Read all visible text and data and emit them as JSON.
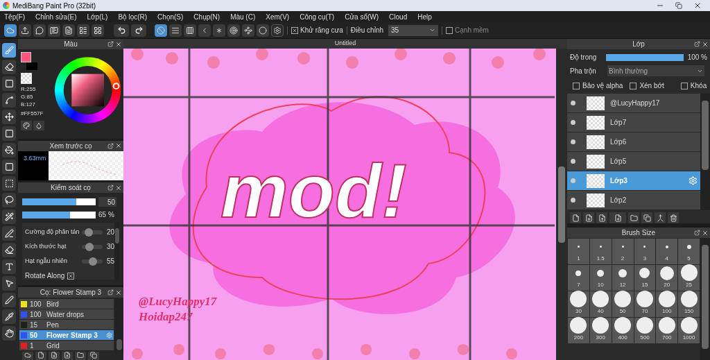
{
  "window": {
    "title": "MediBang Paint Pro (32bit)"
  },
  "menu": [
    "Tệp(F)",
    "Chỉnh sửa(E)",
    "Lớp(L)",
    "Bộ lọc(R)",
    "Chọn(S)",
    "Chụp(N)",
    "Màu (C)",
    "Xem(V)",
    "Công cụ(T)",
    "Cửa sổ(W)",
    "Cloud",
    "Help"
  ],
  "toolbar": {
    "snap_modes": [
      {
        "kind": "none",
        "selected": true
      },
      {
        "kind": "parallel",
        "selected": false
      },
      {
        "kind": "cross",
        "selected": false
      },
      {
        "kind": "vanish",
        "selected": false
      },
      {
        "kind": "radial",
        "selected": false
      },
      {
        "kind": "circle",
        "selected": false
      },
      {
        "kind": "curve",
        "selected": false
      },
      {
        "kind": "ellipse",
        "selected": false
      }
    ],
    "antialias": {
      "label": "Khử răng cưa",
      "checked": true
    },
    "correction": {
      "label": "Điều chỉnh",
      "value": "35"
    },
    "soft_edge": {
      "label": "Cạnh mềm",
      "checked": false
    }
  },
  "tools": [
    {
      "kind": "brush",
      "selected": true
    },
    {
      "kind": "eraser",
      "selected": false
    },
    {
      "kind": "dot",
      "selected": false
    },
    {
      "kind": "vector",
      "selected": false
    },
    {
      "kind": "move",
      "selected": false
    },
    {
      "kind": "fill",
      "selected": false
    },
    {
      "kind": "bucket",
      "selected": false
    },
    {
      "kind": "gradient",
      "selected": false
    },
    {
      "kind": "select",
      "selected": false
    },
    {
      "kind": "lasso",
      "selected": false
    },
    {
      "kind": "wand",
      "selected": false
    },
    {
      "kind": "selpen",
      "selected": false
    },
    {
      "kind": "selerase",
      "selected": false
    },
    {
      "kind": "text",
      "selected": false
    },
    {
      "kind": "operation",
      "selected": false
    },
    {
      "kind": "divide",
      "selected": false
    },
    {
      "kind": "dropper",
      "selected": false
    },
    {
      "kind": "hand",
      "selected": false
    }
  ],
  "color_panel": {
    "title": "Màu",
    "color": "#ff557f",
    "r": "R:255",
    "g": "G:85",
    "b": "B:127",
    "hex": "#FF557F"
  },
  "brush_preview": {
    "title": "Xem trước cọ",
    "size": "3.63mm"
  },
  "brush_control": {
    "title": "Kiểm soát cọ",
    "size": {
      "level": 0.74,
      "reading": "50"
    },
    "opacity": {
      "level": 0.65,
      "reading": "65 %"
    },
    "params": [
      {
        "label": "Cường độ phân tán",
        "level": 0.2,
        "reading": "20"
      },
      {
        "label": "Kích thước hạt",
        "level": 0.3,
        "reading": "30"
      },
      {
        "label": "Hạt ngẫu nhiên",
        "level": 0.55,
        "reading": "55"
      }
    ],
    "rotate": {
      "label": "Rotate Along",
      "checked": true
    }
  },
  "brush_list": {
    "title": "Cọ: Flower Stamp 3",
    "items": [
      {
        "size": "100",
        "name": "Bird",
        "color": "#f0e020",
        "selected": false
      },
      {
        "size": "100",
        "name": "Water drops",
        "color": "#3050f0",
        "selected": false
      },
      {
        "size": "15",
        "name": "Pen",
        "color": "#202020",
        "selected": false
      },
      {
        "size": "50",
        "name": "Flower Stamp 3",
        "color": "#3050f0",
        "selected": true
      },
      {
        "size": "1",
        "name": "Grid",
        "color": "#e02020",
        "selected": false
      }
    ]
  },
  "canvas": {
    "tab": "Untitled",
    "lettering": "mod!",
    "credit": [
      "@LucyHappy17",
      "Hoidap247"
    ]
  },
  "layer_panel": {
    "title": "Lớp",
    "opacity": {
      "label": "Độ trong",
      "level": 1,
      "reading": "100 %"
    },
    "blend": {
      "label": "Pha trộn",
      "value": "Bình thường"
    },
    "options": [
      {
        "label": "Bảo vệ alpha",
        "checked": false
      },
      {
        "label": "Xén bớt",
        "checked": false
      },
      {
        "label": "Khóa",
        "checked": false
      }
    ],
    "layers": [
      {
        "name": "@LucyHappy17",
        "selected": false
      },
      {
        "name": "Lớp7",
        "selected": false
      },
      {
        "name": "Lớp6",
        "selected": false
      },
      {
        "name": "Lớp5",
        "selected": false
      },
      {
        "name": "Lớp3",
        "selected": true
      },
      {
        "name": "Lớp2",
        "selected": false
      }
    ]
  },
  "brush_size": {
    "title": "Brush Size",
    "sizes": [
      "1",
      "1.5",
      "2",
      "3",
      "4",
      "5",
      "7",
      "10",
      "12",
      "15",
      "20",
      "25",
      "30",
      "40",
      "50",
      "70",
      "100",
      "150",
      "200",
      "300",
      "400",
      "500",
      "700",
      "1000"
    ]
  }
}
